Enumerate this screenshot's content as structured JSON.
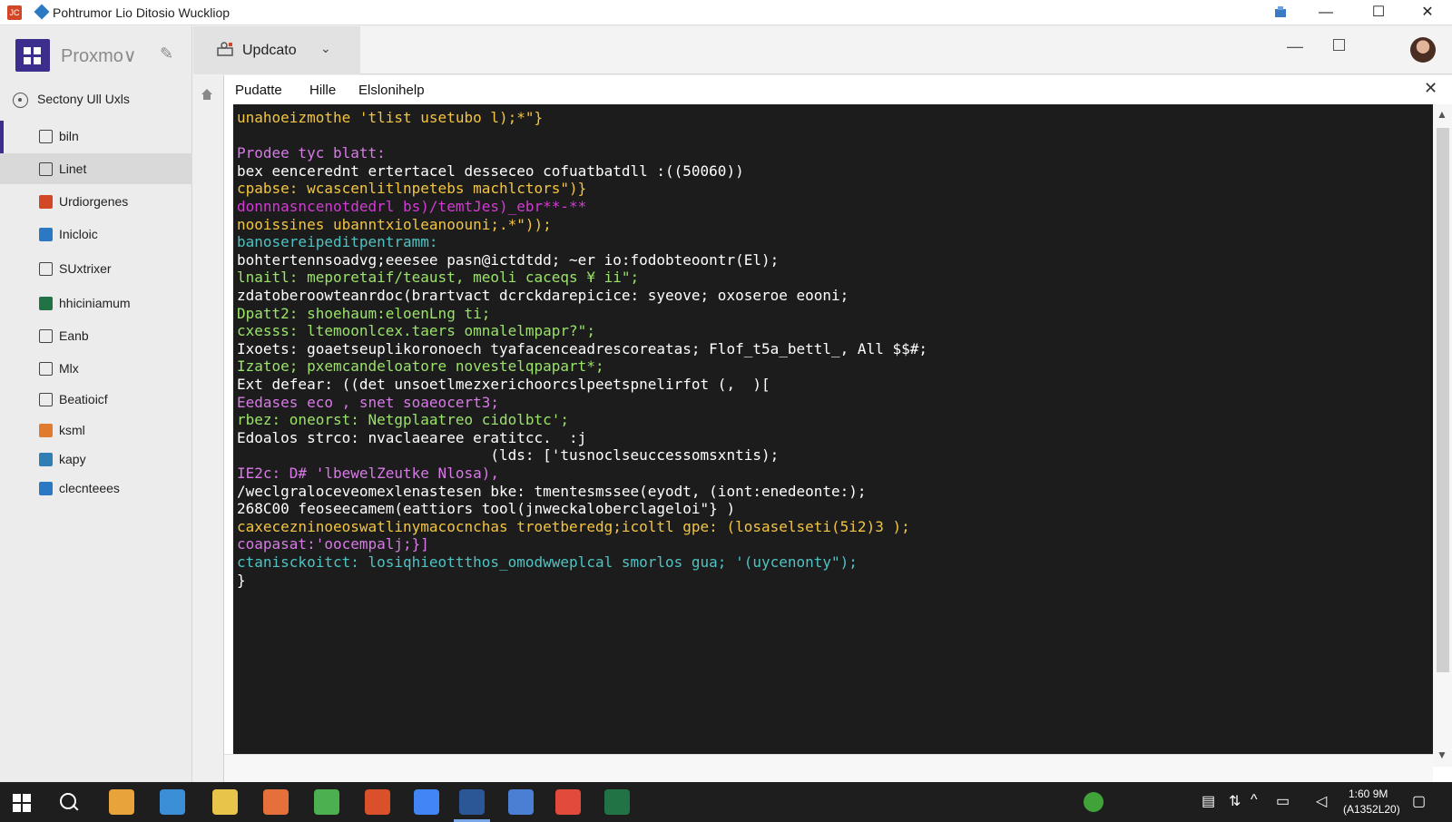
{
  "window": {
    "title": "Pohtrumor Lio Ditosio Wuckliop",
    "controls": {
      "minimize": "—",
      "maximize": "☐",
      "close": "✕"
    }
  },
  "sidebar": {
    "brand": "Proxmo∨",
    "section_label": "Sectony Ull Uxls",
    "items": [
      {
        "label": "biln",
        "icon": "document-icon",
        "color": "#444444"
      },
      {
        "label": "Linet",
        "icon": "rectangle-icon",
        "color": "#444444",
        "selected": true
      },
      {
        "label": "Urdiorgenes",
        "icon": "orange-square-icon",
        "color": "#d24726"
      },
      {
        "label": "Inicloic",
        "icon": "blue-box-icon",
        "color": "#2b79c2"
      },
      {
        "label": "SUxtrixer",
        "icon": "clipboard-icon",
        "color": "#444444"
      },
      {
        "label": "hhiciniamum",
        "icon": "green-book-icon",
        "color": "#217346"
      },
      {
        "label": "Eanb",
        "icon": "square-icon",
        "color": "#444444"
      },
      {
        "label": "Mlx",
        "icon": "external-icon",
        "color": "#444444"
      },
      {
        "label": "Beatioicf",
        "icon": "grid-icon",
        "color": "#444444"
      },
      {
        "label": "ksml",
        "icon": "orange-bar-icon",
        "color": "#e07b2e"
      },
      {
        "label": "kapy",
        "icon": "teal-bar-icon",
        "color": "#2f7fb5"
      },
      {
        "label": "clecnteees",
        "icon": "circle-icon",
        "color": "#2b79c2"
      }
    ]
  },
  "ribbon": {
    "tab_label": "Updcato",
    "chevron": "⌄",
    "min": "—"
  },
  "document": {
    "menu": [
      "Pudatte",
      "Hille",
      "Elslonihelp"
    ],
    "close": "✕",
    "code_lines": [
      {
        "text": "unahoeizmothe 'tlist usetubo l);*\"}",
        "color": "#f2c542"
      },
      {
        "text": "",
        "color": "#ffffff"
      },
      {
        "text": "Prodee tyc blatt:",
        "color": "#d77ae6"
      },
      {
        "text": "bex eencerednt ertertacel desseceo cofuatbatdll :((50060))",
        "color": "#ffffff"
      },
      {
        "text": "cpabse: wcascenlitlnpetebs machlctors\")}",
        "color": "#f2c542"
      },
      {
        "text": "donnnasncenotdedrl bs)/temtJes)_ebr**-**",
        "color": "#d43bd4"
      },
      {
        "text": "nooissines ubanntxioleanoouni;.*\"));",
        "color": "#f2c542"
      },
      {
        "text": "banosereipeditpentramm:",
        "color": "#4fc3c3"
      },
      {
        "text": "bohtertennsoadvg;eeesee pasn@ictdtdd; ~er io:fodobteoontr(El);",
        "color": "#ffffff"
      },
      {
        "text": "lnaitl: meporetaif/teaust, meoli caceqs ¥ ii\";",
        "color": "#9be36b"
      },
      {
        "text": "zdatoberoowteanrdoc(brartvact dcrckdarepicice: syeove; oxoseroe eooni;",
        "color": "#ffffff"
      },
      {
        "text": "Dpatt2: shoehaum:eloenLng ti;",
        "color": "#9be36b"
      },
      {
        "text": "cxesss: ltemoonlcex.taers omnalelmpapr?\";",
        "color": "#9be36b"
      },
      {
        "text": "Ixoets: goaetseuplikoronoech tyafacenceadrescoreatas; Flof_t5a_bettl_, All $$#;",
        "color": "#ffffff"
      },
      {
        "text": "Izatoe; pxemcandeloatore novestelqpapart*;",
        "color": "#9be36b"
      },
      {
        "text": "Ext defear: ((det unsoetlmezxerichoorcslpeetspnelirfot (,  )[",
        "color": "#ffffff"
      },
      {
        "text": "Eedases eco , snet soaeocert3;",
        "color": "#d77ae6"
      },
      {
        "text": "rbez: oneorst: Netgplaatreo cidolbtc';",
        "color": "#9be36b"
      },
      {
        "text": "Edoalos strco: nvaclaearee eratitcc.  :j",
        "color": "#ffffff"
      },
      {
        "text": "                             (lds: ['tusnoclseuccessomsxntis);",
        "color": "#ffffff"
      },
      {
        "text": "IE2c: D# 'lbewelZeutke Nlosa),",
        "color": "#d77ae6"
      },
      {
        "text": "/weclgraloceveomexlenastesen bke: tmentesmssee(eyodt, (iont:enedeonte:);",
        "color": "#ffffff"
      },
      {
        "text": "268C00 feoseecamem(eattiors tool(jnweckaloberclageloi\"} )",
        "color": "#ffffff"
      },
      {
        "text": "caxecezninoeoswatlinymacocnchas troetberedg;icoltl gpe: (losaselseti(5i2)3 );",
        "color": "#f2c542"
      },
      {
        "text": "coapasat:'oocempalj;}]",
        "color": "#d77ae6"
      },
      {
        "text": "ctanisckoitct: losiqhieottthos_omodwweplcal smorlos gua; '(uycenonty\");",
        "color": "#4fc3c3"
      },
      {
        "text": "}",
        "color": "#ffffff"
      }
    ]
  },
  "taskbar": {
    "apps": [
      {
        "icon": "files-icon",
        "color": "#e8a33b"
      },
      {
        "icon": "globe-icon",
        "color": "#3b8fd6"
      },
      {
        "icon": "folder-icon",
        "color": "#e8c44a"
      },
      {
        "icon": "firefox-icon",
        "color": "#e6703b"
      },
      {
        "icon": "chrome-icon",
        "color": "#4caf50"
      },
      {
        "icon": "browser-icon",
        "color": "#d9502b"
      },
      {
        "icon": "google-icon",
        "color": "#4285f4"
      },
      {
        "icon": "word-icon",
        "color": "#2b5797"
      },
      {
        "icon": "store-icon",
        "color": "#4a7fd4"
      },
      {
        "icon": "pdf-icon",
        "color": "#e24a3b"
      },
      {
        "icon": "excel-icon",
        "color": "#217346"
      }
    ],
    "clock_time": "1:60 9M",
    "clock_date": "(A1352L20)"
  }
}
